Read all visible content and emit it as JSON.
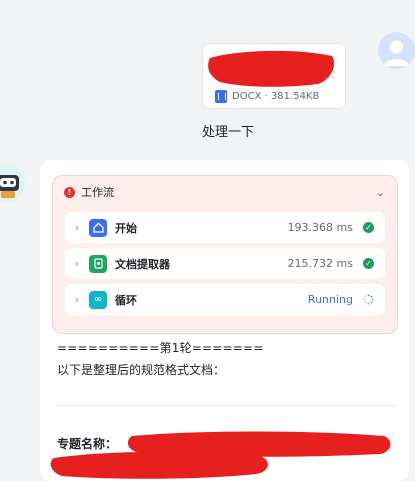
{
  "user_message": {
    "file": {
      "ellipsis": "...",
      "meta": "DOCX · 381.54KB"
    },
    "text": "处理一下"
  },
  "assistant": {
    "workflow": {
      "title": "工作流",
      "nodes": [
        {
          "label": "开始",
          "time": "193.368 ms",
          "icon": "home-icon",
          "color": "#3b6ef5"
        },
        {
          "label": "文档提取器",
          "time": "215.732 ms",
          "icon": "document-extractor-icon",
          "color": "#21a366"
        },
        {
          "label": "循环",
          "status": "Running",
          "icon": "loop-icon",
          "color": "#0fb5c8"
        }
      ]
    },
    "round_line": "==========第1轮=======",
    "intro_line": "以下是整理后的规范格式文档：",
    "section_label": "专题名称："
  },
  "colors": {
    "accent": "#3b6ef5",
    "success": "#1b9e5a",
    "error": "#e0342e",
    "redaction": "#e6201f"
  }
}
